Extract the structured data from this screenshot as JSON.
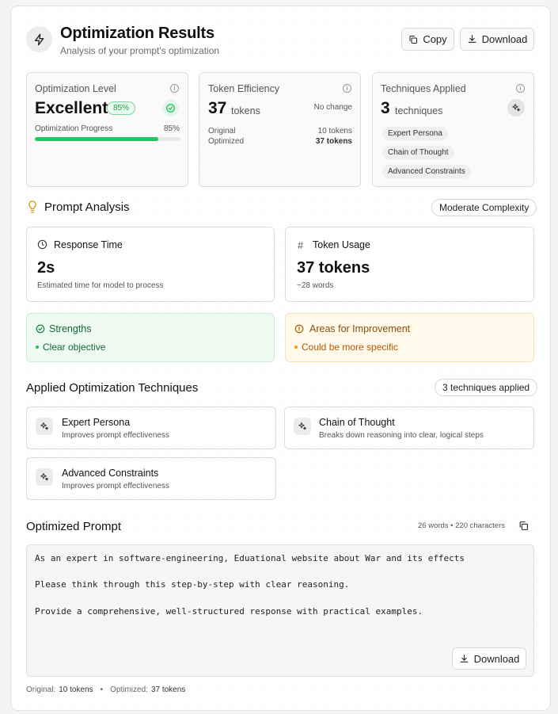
{
  "header": {
    "title": "Optimization Results",
    "subtitle": "Analysis of your prompt's optimization",
    "copy_label": "Copy",
    "download_label": "Download"
  },
  "stats": {
    "level": {
      "label": "Optimization Level",
      "value": "Excellent",
      "badge": "85%",
      "progress_label": "Optimization Progress",
      "progress_text": "85%",
      "progress": 0.85
    },
    "tokens": {
      "label": "Token Efficiency",
      "value": "37",
      "unit": "tokens",
      "change": "No change",
      "original_label": "Original",
      "original_value": "10 tokens",
      "optimized_label": "Optimized",
      "optimized_value": "37 tokens"
    },
    "techniques": {
      "label": "Techniques Applied",
      "value": "3",
      "unit": "techniques",
      "tags": [
        "Expert Persona",
        "Chain of Thought",
        "Advanced Constraints"
      ]
    }
  },
  "analysis": {
    "title": "Prompt Analysis",
    "complexity": "Moderate Complexity",
    "response_time": {
      "label": "Response Time",
      "value": "2s",
      "note": "Estimated time for model to process"
    },
    "token_usage": {
      "label": "Token Usage",
      "value": "37 tokens",
      "note": "~28 words"
    },
    "strengths": {
      "title": "Strengths",
      "items": [
        "Clear objective"
      ]
    },
    "improvements": {
      "title": "Areas for Improvement",
      "items": [
        "Could be more specific"
      ]
    }
  },
  "techniques_section": {
    "title": "Applied Optimization Techniques",
    "count_badge": "3 techniques applied",
    "items": [
      {
        "name": "Expert Persona",
        "desc": "Improves prompt effectiveness"
      },
      {
        "name": "Chain of Thought",
        "desc": "Breaks down reasoning into clear, logical steps"
      },
      {
        "name": "Advanced Constraints",
        "desc": "Improves prompt effectiveness"
      }
    ]
  },
  "optimized": {
    "title": "Optimized Prompt",
    "meta": "26 words • 220 characters",
    "lines": [
      "As an expert in software-engineering, Eduational website about War and its effects",
      "Please think through this step-by-step with clear reasoning.",
      "Provide a comprehensive, well-structured response with practical examples."
    ],
    "download_label": "Download"
  },
  "footer": {
    "original_label": "Original:",
    "original_value": "10 tokens",
    "separator": "•",
    "optimized_label": "Optimized:",
    "optimized_value": "37 tokens"
  },
  "colors": {
    "green": "#22c55e",
    "amber": "#d99a0b",
    "amber_text": "#8a4b0f"
  }
}
